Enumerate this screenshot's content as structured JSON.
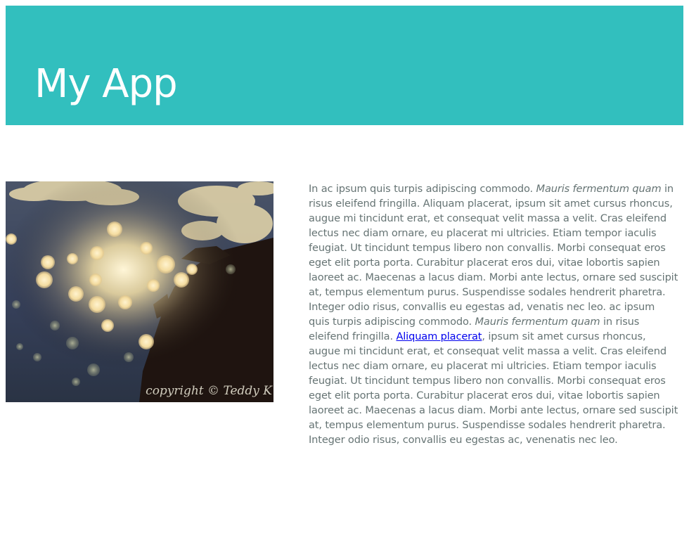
{
  "header": {
    "title": "My App",
    "background_color": "#32bfbe"
  },
  "photo": {
    "caption": "copyright © Teddy K",
    "description_icon": "bokeh-photo"
  },
  "article": {
    "segments": [
      "In ac ipsum quis turpis adipiscing commodo. ",
      "Mauris fermentum quam",
      " in risus eleifend fringilla. Aliquam placerat, ipsum sit amet cursus rhoncus, augue mi tincidunt erat, et consequat velit massa a velit. Cras eleifend lectus nec diam ornare, eu placerat mi ultricies. Etiam tempor iaculis feugiat. Ut tincidunt tempus libero non convallis. Morbi consequat eros eget elit porta porta. Curabitur placerat eros dui, vitae lobortis sapien laoreet ac. Maecenas a lacus diam. Morbi ante lectus, ornare sed suscipit at, tempus elementum purus. Suspendisse sodales hendrerit pharetra. Integer odio risus, convallis eu egestas ad, venatis nec leo. ac ipsum quis turpis adipiscing commodo. ",
      "Mauris fermentum quam",
      " in risus eleifend fringilla. ",
      "Aliquam placerat",
      ", ipsum sit amet cursus rhoncus, augue mi tincidunt erat, et consequat velit massa a velit. Cras eleifend lectus nec diam ornare, eu placerat mi ultricies. Etiam tempor iaculis feugiat. Ut tincidunt tempus libero non convallis. Morbi consequat eros eget elit porta porta. Curabitur placerat eros dui, vitae lobortis sapien laoreet ac. Maecenas a lacus diam. Morbi ante lectus, ornare sed suscipit at, tempus elementum purus. Suspendisse sodales hendrerit pharetra. Integer odio risus, convallis eu egestas ac, venenatis nec leo."
    ],
    "text_color": "#667474",
    "link_color": "#0000ee"
  }
}
